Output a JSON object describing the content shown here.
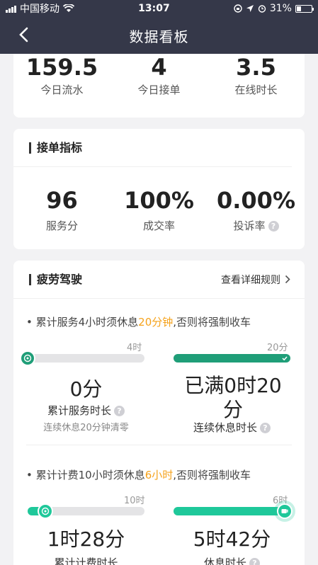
{
  "status": {
    "carrier": "中国移动",
    "time": "13:07",
    "battery": "31%",
    "battery_level": 0.31
  },
  "nav": {
    "title": "数据看板"
  },
  "summary": [
    {
      "value": "159.5",
      "label": "今日流水"
    },
    {
      "value": "4",
      "label": "今日接单"
    },
    {
      "value": "3.5",
      "label": "在线时长"
    }
  ],
  "orders": {
    "title": "接单指标",
    "stats": [
      {
        "value": "96",
        "label": "服务分"
      },
      {
        "value": "100%",
        "label": "成交率"
      },
      {
        "value": "0.00%",
        "label": "投诉率"
      }
    ]
  },
  "fatigue": {
    "title": "疲劳驾驶",
    "link": "查看详细规则",
    "rule1": {
      "pre": "• 累计服务4小时须休息",
      "hl": "20分钟",
      "post": ",否则将强制收车"
    },
    "service": {
      "max": "4时",
      "value": "0分",
      "label": "累计服务时长",
      "sub": "连续休息20分钟清零",
      "progress": 0.0
    },
    "rest1": {
      "max": "20分",
      "value": "已满0时20分",
      "label": "连续休息时长",
      "progress": 1.0
    },
    "rule2": {
      "pre": "• 累计计费10小时须休息",
      "hl": "6小时",
      "post": ",否则将强制收车"
    },
    "billing": {
      "max": "10时",
      "value": "1时28分",
      "label": "累计计费时长",
      "progress": 0.15
    },
    "rest2": {
      "max": "6时",
      "value": "5时42分",
      "label": "休息时长",
      "progress": 0.95
    }
  },
  "colors": {
    "header": "#353849",
    "green": "#1f9e78",
    "orange": "#f5a21b",
    "bright_green": "#1fc89a"
  }
}
